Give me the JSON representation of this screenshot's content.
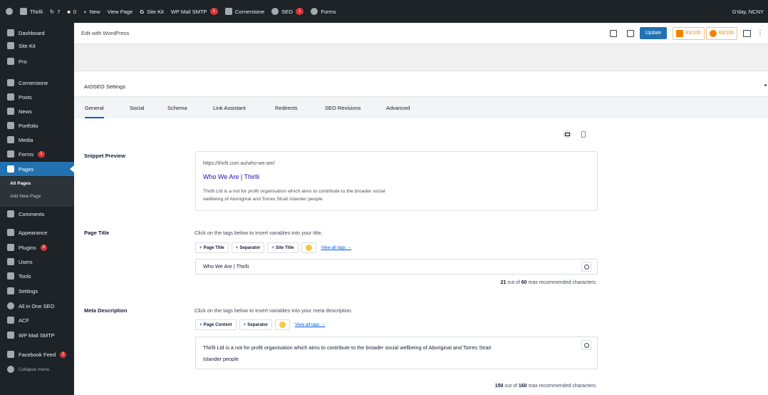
{
  "adminbar": {
    "site_name": "Thirlli",
    "customizer_count": "7",
    "comments_count": "0",
    "new_label": "New",
    "view_page_label": "View Page",
    "sitekit_label": "Site Kit",
    "smtp_label": "WP Mail SMTP",
    "smtp_badge": "1",
    "cornerstone_label": "Cornerstone",
    "seo_label": "SEO",
    "seo_badge": "1",
    "forms_label": "Forms",
    "greeting": "G'day, NCNY"
  },
  "sidebar": {
    "items": [
      {
        "label": "Dashboard",
        "icon": "dashboard-icon"
      },
      {
        "label": "Site Kit",
        "icon": "sitekit-icon"
      },
      {
        "label": "Pro",
        "icon": "pro-icon"
      },
      {
        "label": "Cornerstone",
        "icon": "cornerstone-icon"
      },
      {
        "label": "Posts",
        "icon": "pin-icon"
      },
      {
        "label": "News",
        "icon": "pin-icon"
      },
      {
        "label": "Portfolio",
        "icon": "portfolio-icon"
      },
      {
        "label": "Media",
        "icon": "media-icon"
      },
      {
        "label": "Forms",
        "icon": "forms-icon",
        "badge": "1"
      },
      {
        "label": "Pages",
        "icon": "pages-icon"
      },
      {
        "label": "Comments",
        "icon": "comment-icon"
      },
      {
        "label": "Appearance",
        "icon": "brush-icon"
      },
      {
        "label": "Plugins",
        "icon": "plugin-icon",
        "badge": "3"
      },
      {
        "label": "Users",
        "icon": "users-icon"
      },
      {
        "label": "Tools",
        "icon": "wrench-icon"
      },
      {
        "label": "Settings",
        "icon": "settings-icon"
      },
      {
        "label": "All in One SEO",
        "icon": "aioseo-icon"
      },
      {
        "label": "ACF",
        "icon": "acf-icon"
      },
      {
        "label": "WP Mail SMTP",
        "icon": "mail-icon"
      },
      {
        "label": "Facebook Feed",
        "icon": "facebook-icon",
        "badge": "1"
      },
      {
        "label": "Collapse menu",
        "icon": "collapse-icon"
      }
    ],
    "submenu": {
      "all_pages": "All Pages",
      "add_new": "Add New Page"
    }
  },
  "editor": {
    "title": "Edit with WordPress",
    "update_label": "Update",
    "score1": "43/100",
    "score2": "60/100"
  },
  "aioseo": {
    "heading": "AIOSEO Settings",
    "tabs": [
      "General",
      "Social",
      "Schema",
      "Link Assistant",
      "Redirects",
      "SEO Revisions",
      "Advanced"
    ],
    "snippet": {
      "label": "Snippet Preview",
      "url": "https://thirlli.com.au/who-we-are/",
      "title": "Who We Are | Thirlli",
      "description_line1": "Thirlli Ltd is a not for profit organisation which aims to contribute to the broader social",
      "description_line2": "wellbeing of Aboriginal and Torres Strait Islander people"
    },
    "page_title": {
      "label": "Page Title",
      "help": "Click on the tags below to insert variables into your title.",
      "tags": [
        "Page Title",
        "Separator",
        "Site Title"
      ],
      "view_all": "View all tags →",
      "value": "Who We Are | Thirlli",
      "count": "21",
      "max": "60",
      "counter_suffix": "max recommended characters."
    },
    "meta_description": {
      "label": "Meta Description",
      "help": "Click on the tags below to insert variables into your meta description.",
      "tags": [
        "Page Content",
        "Separator"
      ],
      "view_all": "View all tags →",
      "value_line1": "Thirlli Ltd is a not for profit organisation which aims to contribute to the broader social wellbeing of Aboriginal and Torres Strait",
      "value_line2": "Islander people",
      "count": "150",
      "max": "160",
      "counter_suffix": "max recommended characters."
    },
    "out_of": "out of"
  },
  "colors": {
    "admin_bg": "#1d2327",
    "accent": "#2271b1",
    "aioseo_blue": "#005ae0",
    "badge_red": "#d63638",
    "score_orange": "#f18200"
  }
}
